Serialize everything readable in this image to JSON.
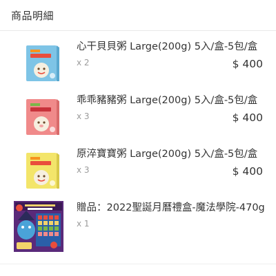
{
  "header": {
    "title": "商品明細"
  },
  "items": [
    {
      "name": "心干貝貝粥 Large(200g) 5入/盒-5包/盒",
      "qty": "x 2",
      "price": "$ 400",
      "thumb_color": "#7ec4e6",
      "icon": "porridge-box-blue-icon"
    },
    {
      "name": "乖乖豬豬粥 Large(200g) 5入/盒-5包/盒",
      "qty": "x 3",
      "price": "$ 400",
      "thumb_color": "#f08a8a",
      "icon": "porridge-box-pink-icon"
    },
    {
      "name": "原淬寶寶粥 Large(200g) 5入/盒-5包/盒",
      "qty": "x 3",
      "price": "$ 400",
      "thumb_color": "#f3e56a",
      "icon": "porridge-box-yellow-icon"
    }
  ],
  "gift": {
    "name": "贈品：2022聖誕月曆禮盒-魔法學院-470g",
    "qty": "x 1",
    "icon": "advent-calendar-box-icon"
  }
}
